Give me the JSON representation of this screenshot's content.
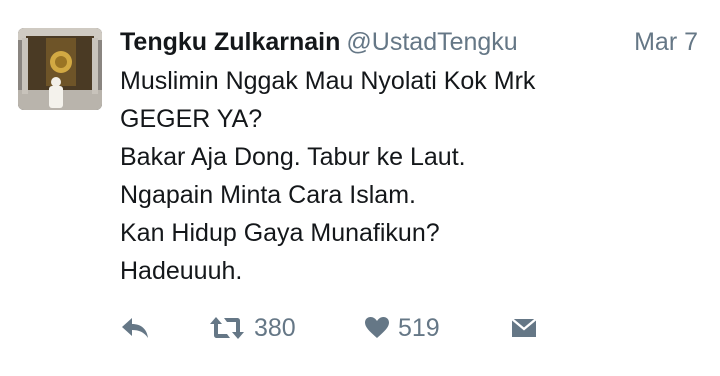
{
  "tweet": {
    "author": {
      "name": "Tengku Zulkarnain",
      "handle": "@UstadTengku"
    },
    "date": "Mar 7",
    "lines": [
      "Muslimin Nggak Mau Nyolati Kok Mrk",
      "GEGER YA?",
      "Bakar Aja Dong. Tabur ke Laut.",
      "Ngapain Minta Cara Islam.",
      "Kan Hidup Gaya Munafikun?",
      "Hadeuuuh."
    ],
    "actions": {
      "reply_icon": "reply-arrow-icon",
      "retweet_icon": "retweet-icon",
      "retweet_count": "380",
      "like_icon": "heart-icon",
      "like_count": "519",
      "dm_icon": "envelope-icon"
    }
  },
  "colors": {
    "text": "#14171a",
    "secondary": "#657786",
    "background": "#ffffff"
  }
}
